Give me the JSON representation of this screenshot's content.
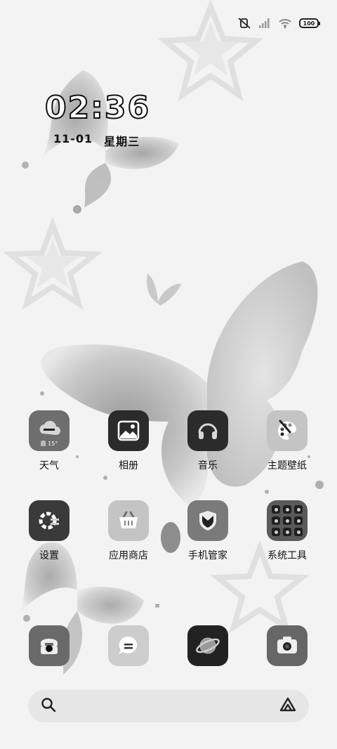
{
  "status_bar": {
    "icons": [
      "mute-vibrate-icon",
      "signal-icon",
      "wifi-icon"
    ],
    "battery": "100"
  },
  "clock": {
    "time": "02:36",
    "date": "11-01",
    "weekday": "星期三"
  },
  "apps_row1": [
    {
      "label": "天气",
      "icon": "weather-icon",
      "weather_text": "霾 15°"
    },
    {
      "label": "相册",
      "icon": "gallery-icon"
    },
    {
      "label": "音乐",
      "icon": "headphones-icon"
    },
    {
      "label": "主题壁纸",
      "icon": "palette-icon"
    }
  ],
  "apps_row2": [
    {
      "label": "设置",
      "icon": "gear-icon"
    },
    {
      "label": "应用商店",
      "icon": "basket-icon"
    },
    {
      "label": "手机管家",
      "icon": "shield-icon"
    },
    {
      "label": "系统工具",
      "icon": "folder-icon"
    }
  ],
  "dock": [
    {
      "icon": "phone-icon"
    },
    {
      "icon": "message-icon"
    },
    {
      "icon": "browser-icon"
    },
    {
      "icon": "camera-icon"
    }
  ],
  "page_indicator": "≡",
  "colors": {
    "background": "#f2f2f2",
    "icon_dark": "#2b2b2b",
    "icon_mid": "#6e6e6e",
    "icon_light": "#c4c4c4"
  }
}
